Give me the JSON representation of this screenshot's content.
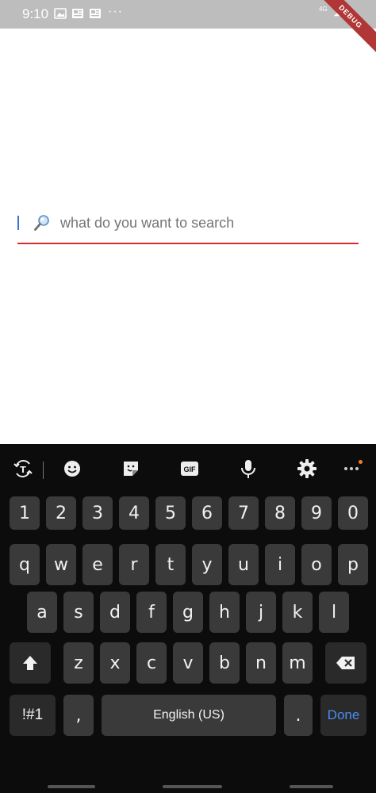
{
  "status_bar": {
    "time": "9:10",
    "more": "···",
    "network": "4G",
    "debug_label": "DEBUG",
    "icons": [
      "gallery-icon",
      "news-icon",
      "news-icon-2",
      "signal-icon"
    ]
  },
  "search": {
    "placeholder": "what do you want to search",
    "value": "",
    "underline_color": "#d32f2f",
    "cursor_color": "#3d6fd6"
  },
  "keyboard": {
    "toolbar": [
      "translate-icon",
      "emoji-icon",
      "sticker-icon",
      "gif-icon",
      "mic-icon",
      "settings-icon",
      "more-icon"
    ],
    "gif_label": "GIF",
    "number_row": [
      "1",
      "2",
      "3",
      "4",
      "5",
      "6",
      "7",
      "8",
      "9",
      "0"
    ],
    "row1": [
      "q",
      "w",
      "e",
      "r",
      "t",
      "y",
      "u",
      "i",
      "o",
      "p"
    ],
    "row2": [
      "a",
      "s",
      "d",
      "f",
      "g",
      "h",
      "j",
      "k",
      "l"
    ],
    "row3": [
      "z",
      "x",
      "c",
      "v",
      "b",
      "n",
      "m"
    ],
    "symbols_label": "!#1",
    "comma_label": ",",
    "space_label": "English (US)",
    "period_label": ".",
    "done_label": "Done",
    "accent_color": "#4a8df0"
  }
}
